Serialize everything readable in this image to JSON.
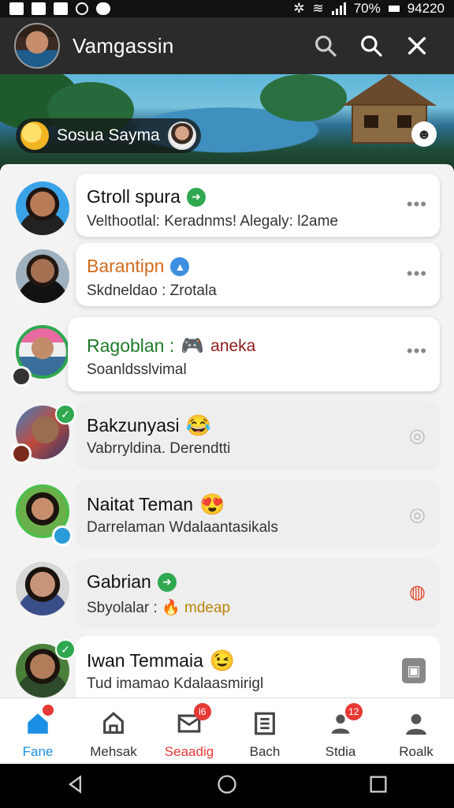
{
  "status_bar": {
    "battery": "70%",
    "time": "94220"
  },
  "header": {
    "title": "Vamgassin",
    "icons": [
      "search-icon",
      "search-icon",
      "close-icon"
    ]
  },
  "banner": {
    "chip_label": "Sosua Sayma"
  },
  "chats": [
    {
      "name": "Gtroll spura",
      "message": "Velthootlal: Keradnms! Alegaly: l2ame",
      "name_color": "#111111"
    },
    {
      "name": "Barantipn",
      "message": "Skdneldao : Zrotala",
      "name_color": "#d46a1c"
    },
    {
      "name": "Ragoblan :",
      "name_suffix": "aneka",
      "message": "Soanldsslvimal",
      "name_color": "#1f7a2a"
    },
    {
      "name": "Bakzunyasi",
      "message": "Vabrryldina. Derendtti",
      "name_color": "#111111"
    },
    {
      "name": "Naitat Teman",
      "message": "Darrelaman Wdalaantasikals",
      "name_color": "#111111"
    },
    {
      "name": "Gabrian",
      "message_prefix": "Sbyolalar :",
      "message": "mdeap",
      "name_color": "#111111"
    },
    {
      "name": "Iwan Temmaia",
      "message": "Tud imamao Kdalaasmirigl",
      "name_color": "#111111"
    }
  ],
  "bottom_nav": [
    {
      "label": "Fane",
      "icon": "home-icon",
      "active": true
    },
    {
      "label": "Mehsak",
      "icon": "house-outline-icon"
    },
    {
      "label": "Seaadig",
      "icon": "mail-icon",
      "badge": "l6"
    },
    {
      "label": "Bach",
      "icon": "list-icon"
    },
    {
      "label": "Stdia",
      "icon": "people-icon",
      "badge": "12"
    },
    {
      "label": "Roalk",
      "icon": "profile-icon"
    }
  ],
  "colors": {
    "accent": "#1a73e8",
    "alert": "#e53935",
    "active_nav": "#1a8fe3"
  }
}
